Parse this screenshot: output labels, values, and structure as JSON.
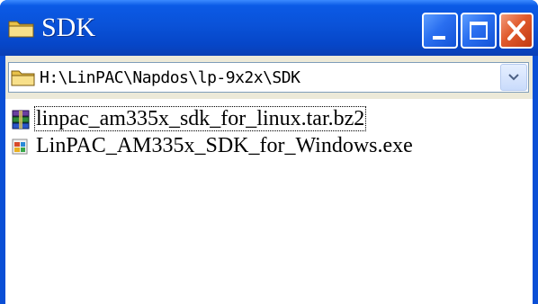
{
  "window": {
    "title": "SDK",
    "title_icon": "folder-icon",
    "controls": {
      "minimize_icon": "minimize-icon",
      "maximize_icon": "maximize-icon",
      "close_icon": "close-icon"
    }
  },
  "address": {
    "path": "H:\\LinPAC\\Napdos\\lp-9x2x\\SDK",
    "icon": "folder-icon",
    "dropdown_icon": "chevron-down-icon"
  },
  "files": [
    {
      "name": "linpac_am335x_sdk_for_linux.tar.bz2",
      "icon": "archive-icon",
      "selected": true
    },
    {
      "name": "LinPAC_AM335x_SDK_for_Windows.exe",
      "icon": "installer-icon",
      "selected": false
    }
  ],
  "colors": {
    "titlebar": "#0a52d8",
    "close_button": "#e05a2c",
    "folder": "#f5d56b"
  }
}
